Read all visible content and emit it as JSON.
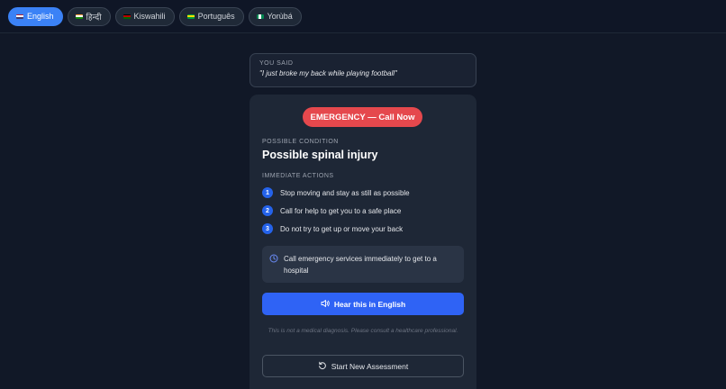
{
  "languages": [
    {
      "label": "English",
      "active": true
    },
    {
      "label": "हिन्दी",
      "active": false
    },
    {
      "label": "Kiswahili",
      "active": false
    },
    {
      "label": "Português",
      "active": false
    },
    {
      "label": "Yorùbá",
      "active": false
    }
  ],
  "you_said": {
    "label": "YOU SAID",
    "text": "\"I just broke my back while playing football\""
  },
  "result": {
    "badge": "EMERGENCY — Call Now",
    "condition_label": "POSSIBLE CONDITION",
    "condition": "Possible spinal injury",
    "actions_label": "IMMEDIATE ACTIONS",
    "actions": [
      {
        "num": "1",
        "text": "Stop moving and stay as still as possible"
      },
      {
        "num": "2",
        "text": "Call for help to get you to a safe place"
      },
      {
        "num": "3",
        "text": "Do not try to get up or move your back"
      }
    ],
    "notice": "Call emergency services immediately to get to a hospital",
    "hear_button": "Hear this in English",
    "disclaimer": "This is not a medical diagnosis. Please consult a healthcare professional.",
    "restart_button": "Start New Assessment"
  },
  "colors": {
    "accent": "#2f63f5",
    "emergency": "#e5484d",
    "background": "#111827",
    "card": "#1e2736"
  },
  "icons": {
    "notice": "clock-icon",
    "hear": "speaker-icon",
    "restart": "refresh-icon"
  }
}
